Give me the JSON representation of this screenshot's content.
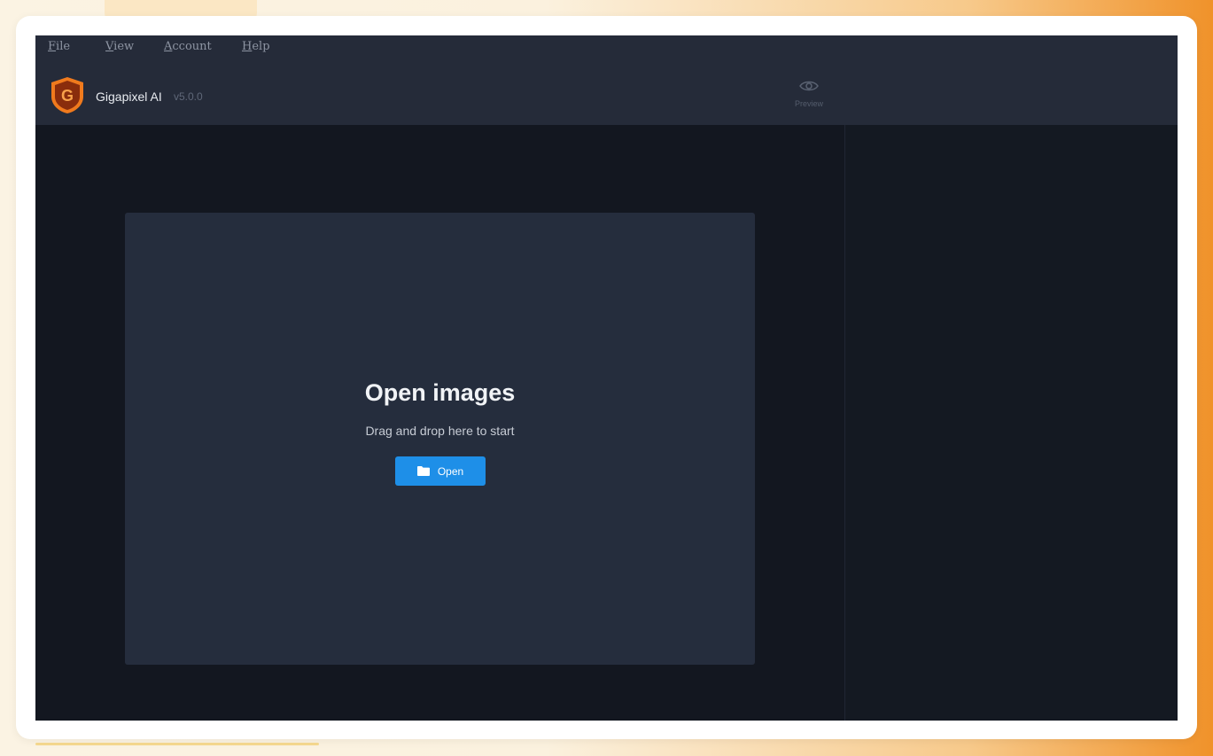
{
  "menu": {
    "items": [
      {
        "label": "File"
      },
      {
        "label": "View"
      },
      {
        "label": "Account"
      },
      {
        "label": "Help"
      }
    ]
  },
  "header": {
    "app_name": "Gigapixel AI",
    "version": "v5.0.0",
    "logo_letter": "G",
    "preview_label": "Preview"
  },
  "dropzone": {
    "title": "Open images",
    "subtitle": "Drag and drop here to start",
    "open_label": "Open"
  },
  "colors": {
    "accent": "#1e8fe8",
    "logo_orange": "#f07a1d",
    "panel_bg": "#252b39",
    "app_bg": "#141820"
  },
  "icons": {
    "logo": "gigapixel-logo",
    "preview": "eye-icon",
    "open": "folder-icon"
  }
}
